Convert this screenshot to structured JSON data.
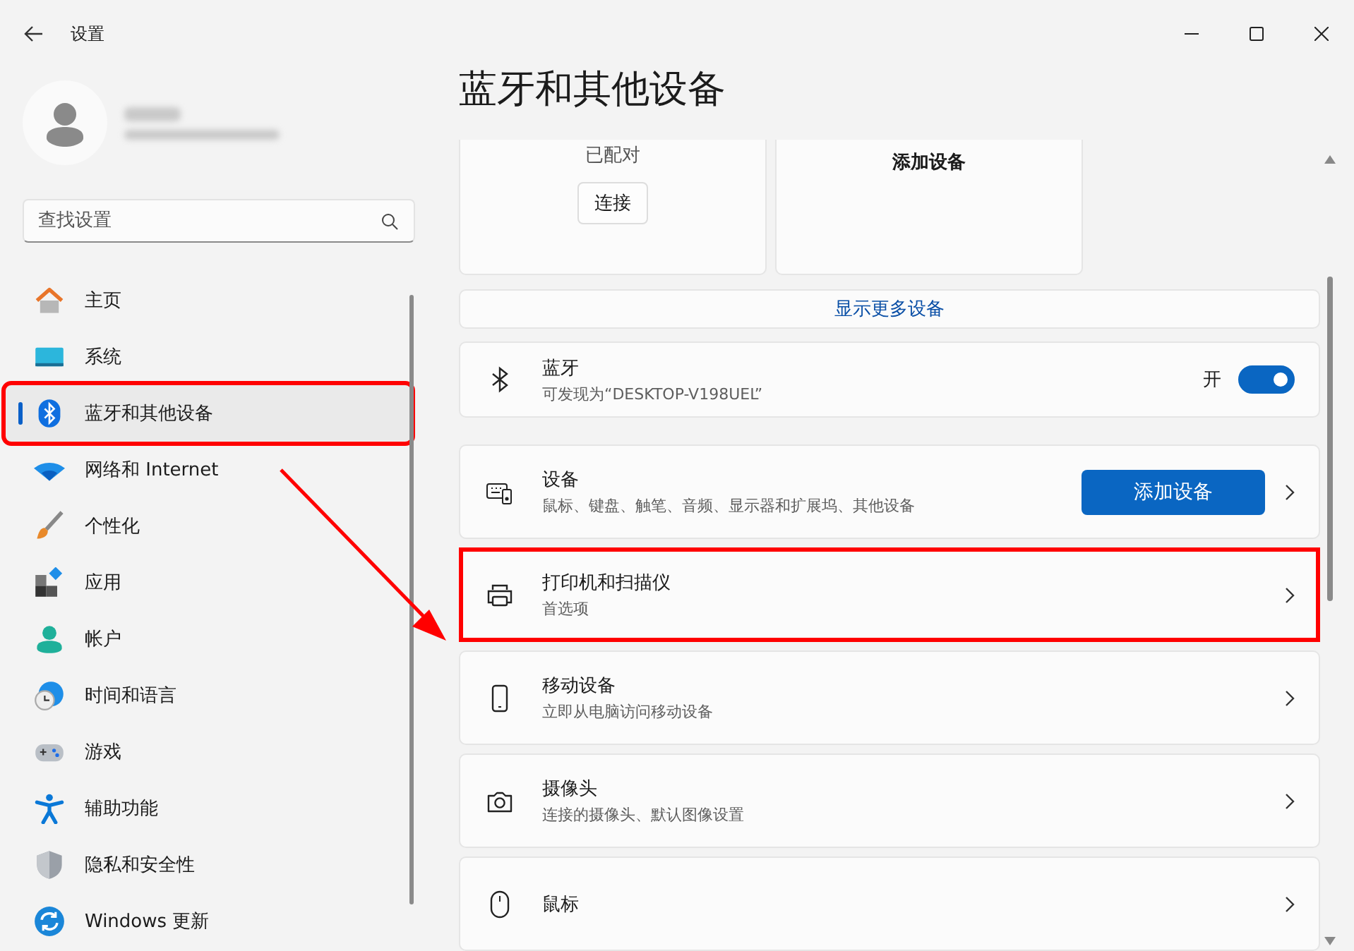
{
  "window": {
    "title": "设置"
  },
  "search": {
    "placeholder": "查找设置"
  },
  "sidebar": {
    "items": [
      {
        "kind": "home",
        "label": "主页",
        "selected": false,
        "highlighted": false
      },
      {
        "kind": "system",
        "label": "系统",
        "selected": false,
        "highlighted": false
      },
      {
        "kind": "bluetooth",
        "label": "蓝牙和其他设备",
        "selected": true,
        "highlighted": true
      },
      {
        "kind": "network",
        "label": "网络和 Internet",
        "selected": false,
        "highlighted": false
      },
      {
        "kind": "brush",
        "label": "个性化",
        "selected": false,
        "highlighted": false
      },
      {
        "kind": "apps",
        "label": "应用",
        "selected": false,
        "highlighted": false
      },
      {
        "kind": "account",
        "label": "帐户",
        "selected": false,
        "highlighted": false
      },
      {
        "kind": "time",
        "label": "时间和语言",
        "selected": false,
        "highlighted": false
      },
      {
        "kind": "gaming",
        "label": "游戏",
        "selected": false,
        "highlighted": false
      },
      {
        "kind": "accessibility",
        "label": "辅助功能",
        "selected": false,
        "highlighted": false
      },
      {
        "kind": "shield",
        "label": "隐私和安全性",
        "selected": false,
        "highlighted": false
      },
      {
        "kind": "update",
        "label": "Windows 更新",
        "selected": false,
        "highlighted": false
      }
    ]
  },
  "page_title": "蓝牙和其他设备",
  "device_tiles": [
    {
      "kind": "paired",
      "status": "已配对",
      "button": "连接"
    },
    {
      "kind": "add",
      "title": "添加设备"
    }
  ],
  "show_more": "显示更多设备",
  "bluetooth": {
    "title": "蓝牙",
    "subtitle": "可发现为“DESKTOP-V198UEL”",
    "state_label": "开",
    "on": true
  },
  "rows": [
    {
      "kind": "devices",
      "title": "设备",
      "subtitle": "鼠标、键盘、触笔、音频、显示器和扩展坞、其他设备",
      "button": "添加设备",
      "highlighted": false
    },
    {
      "kind": "printer",
      "title": "打印机和扫描仪",
      "subtitle": "首选项",
      "highlighted": true
    },
    {
      "kind": "phone",
      "title": "移动设备",
      "subtitle": "立即从电脑访问移动设备",
      "highlighted": false
    },
    {
      "kind": "camera",
      "title": "摄像头",
      "subtitle": "连接的摄像头、默认图像设置",
      "highlighted": false
    },
    {
      "kind": "mouse",
      "title": "鼠标",
      "highlighted": false
    }
  ],
  "annotation_arrow": true
}
